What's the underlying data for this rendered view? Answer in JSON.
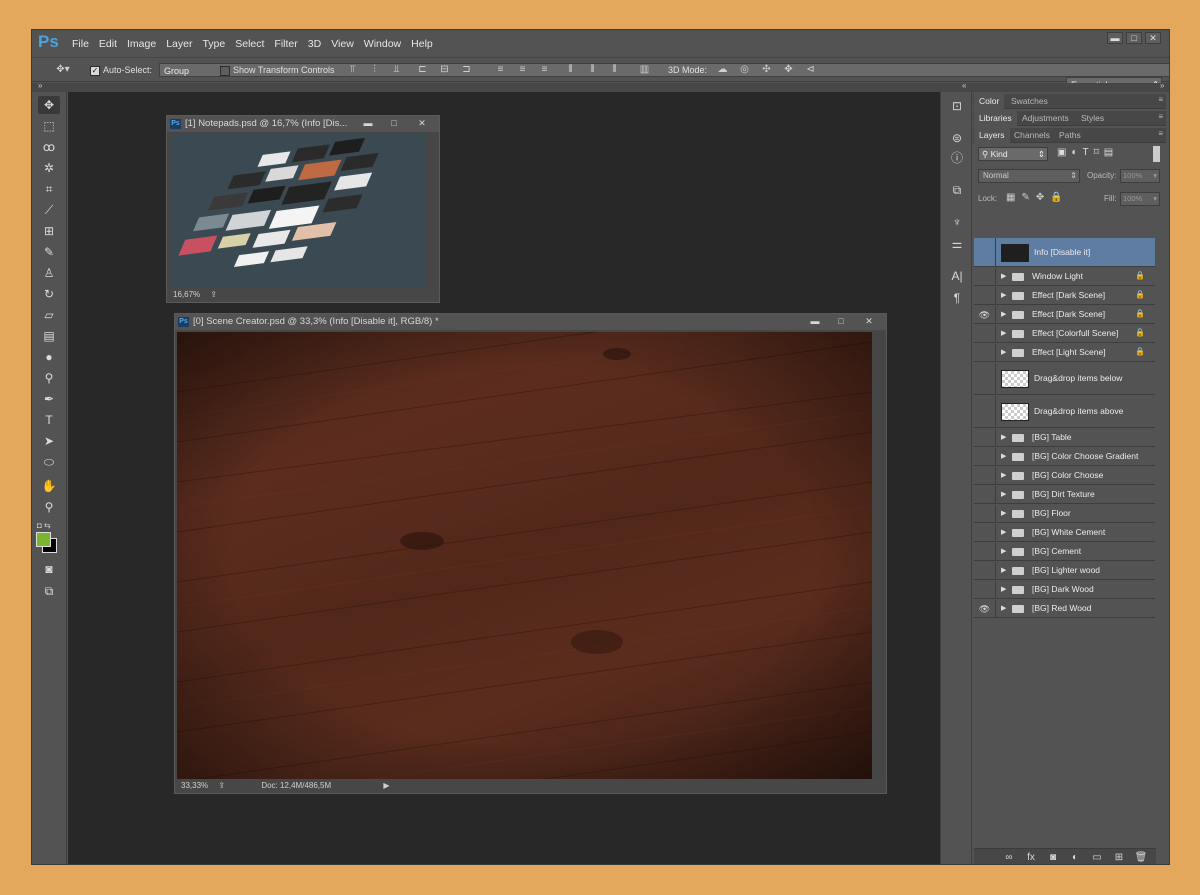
{
  "app": {
    "logo": "Ps"
  },
  "menu": [
    "File",
    "Edit",
    "Image",
    "Layer",
    "Type",
    "Select",
    "Filter",
    "3D",
    "View",
    "Window",
    "Help"
  ],
  "window_controls": {
    "minimize": "▬",
    "maximize": "□",
    "close": "✕"
  },
  "options_bar": {
    "auto_select_label": "Auto-Select:",
    "auto_select_checked": true,
    "group_value": "Group",
    "show_transform_label": "Show Transform Controls",
    "mode_3d_label": "3D Mode:",
    "workspace_value": "Essentials"
  },
  "documents": [
    {
      "title": "[1] Notepads.psd @ 16,7% (Info [Dis...",
      "zoom": "16,67%"
    },
    {
      "title": "[0] Scene Creator.psd @ 33,3% (Info [Disable it], RGB/8) *",
      "zoom": "33,33%",
      "doc_info": "Doc: 12,4M/486,5M"
    }
  ],
  "panels": {
    "row1_tabs": [
      "Color",
      "Swatches"
    ],
    "row2_tabs": [
      "Libraries",
      "Adjustments",
      "Styles"
    ],
    "row3_tabs": [
      "Layers",
      "Channels",
      "Paths"
    ],
    "filter_kind": "Kind",
    "blend_mode": "Normal",
    "opacity_label": "Opacity:",
    "opacity_value": "100%",
    "lock_label": "Lock:",
    "fill_label": "Fill:",
    "fill_value": "100%"
  },
  "layers": [
    {
      "name": "Info [Disable it]",
      "type": "thumb-dark",
      "visible": false,
      "locked": false,
      "selected": true
    },
    {
      "name": "Window Light",
      "type": "group",
      "visible": false,
      "locked": true
    },
    {
      "name": "Effect [Dark Scene]",
      "type": "group",
      "visible": false,
      "locked": true
    },
    {
      "name": "Effect [Dark Scene]",
      "type": "group",
      "visible": true,
      "locked": true
    },
    {
      "name": "Effect [Colorfull Scene]",
      "type": "group",
      "visible": false,
      "locked": true
    },
    {
      "name": "Effect [Light Scene]",
      "type": "group",
      "visible": false,
      "locked": true
    },
    {
      "name": "Drag&drop items below",
      "type": "thumb-empty",
      "visible": false,
      "locked": false
    },
    {
      "name": "Drag&drop items above",
      "type": "thumb-empty",
      "visible": false,
      "locked": false
    },
    {
      "name": "[BG] Table",
      "type": "group",
      "visible": false,
      "locked": false
    },
    {
      "name": "[BG] Color Choose Gradient",
      "type": "group",
      "visible": false,
      "locked": false
    },
    {
      "name": "[BG] Color Choose",
      "type": "group",
      "visible": false,
      "locked": false
    },
    {
      "name": "[BG] Dirt Texture",
      "type": "group",
      "visible": false,
      "locked": false
    },
    {
      "name": "[BG] Floor",
      "type": "group",
      "visible": false,
      "locked": false
    },
    {
      "name": "[BG] White Cement",
      "type": "group",
      "visible": false,
      "locked": false
    },
    {
      "name": "[BG] Cement",
      "type": "group",
      "visible": false,
      "locked": false
    },
    {
      "name": "[BG] Lighter wood",
      "type": "group",
      "visible": false,
      "locked": false
    },
    {
      "name": "[BG] Dark Wood",
      "type": "group",
      "visible": false,
      "locked": false
    },
    {
      "name": "[BG] Red Wood",
      "type": "group",
      "visible": true,
      "locked": false
    }
  ],
  "colors": {
    "foreground": "#7ab62e",
    "background": "#000000",
    "selected_layer": "#5f7ca3",
    "wood": "#5a2c1d"
  }
}
